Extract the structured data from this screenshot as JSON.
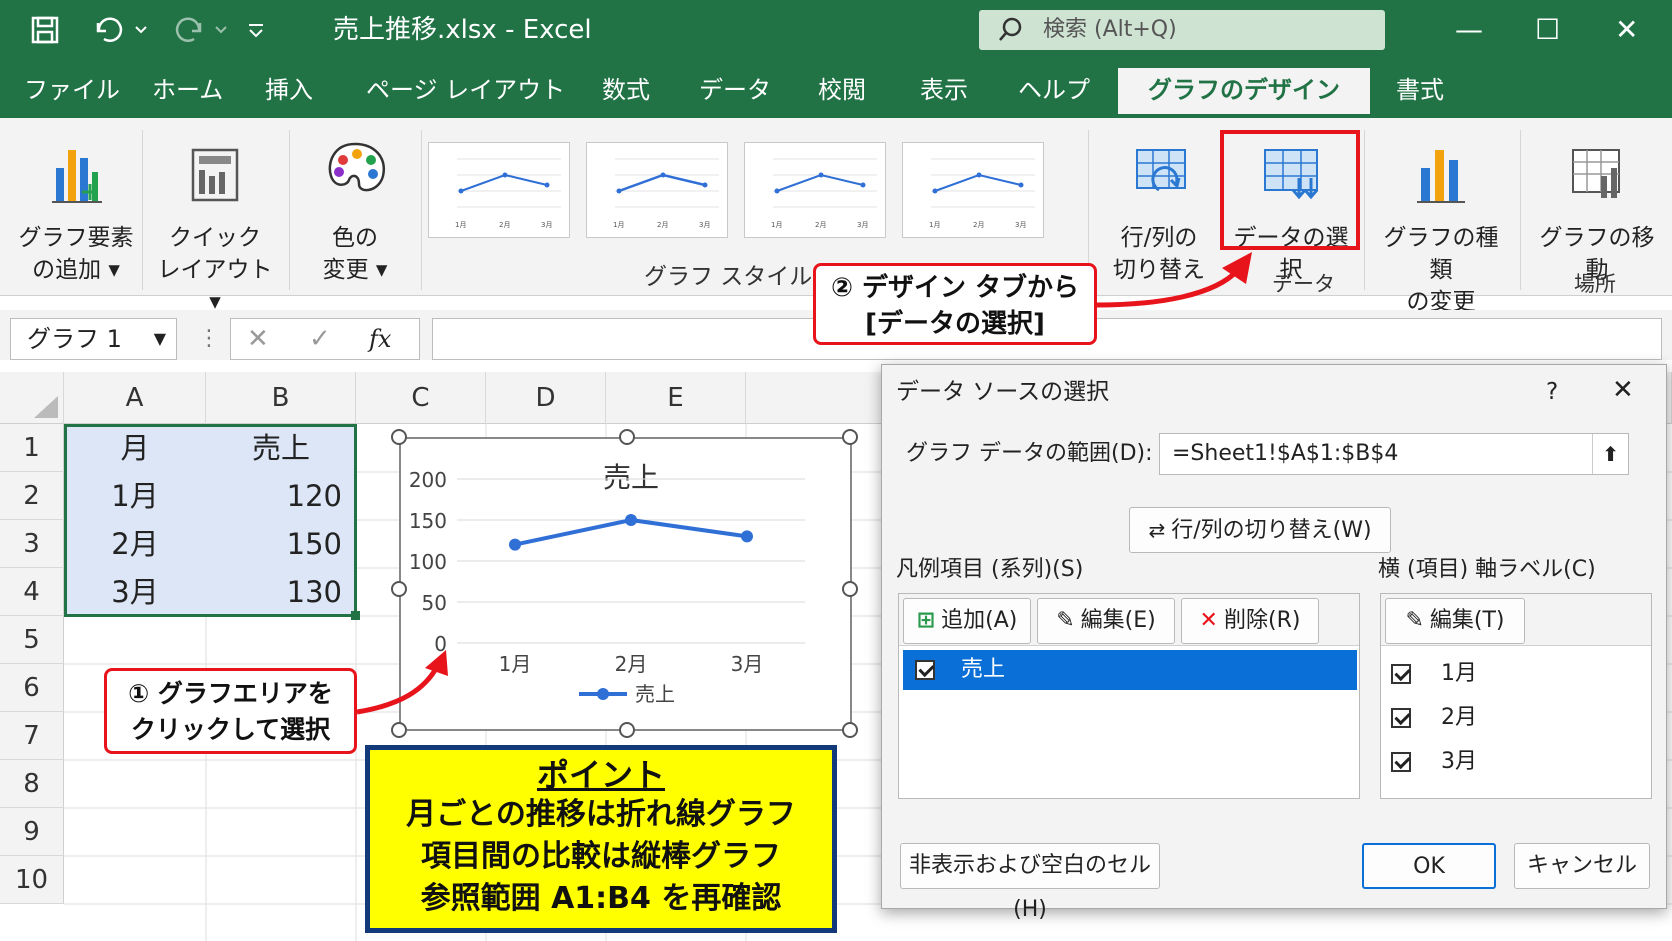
{
  "window": {
    "title": "売上推移.xlsx  -  Excel",
    "search_placeholder": "検索 (Alt+Q)",
    "min": "—",
    "max": "☐",
    "close": "✕"
  },
  "menu": {
    "tabs": [
      {
        "label": "ファイル"
      },
      {
        "label": "ホーム"
      },
      {
        "label": "挿入"
      },
      {
        "label": "ページ レイアウト"
      },
      {
        "label": "数式"
      },
      {
        "label": "データ"
      },
      {
        "label": "校閲"
      },
      {
        "label": "表示"
      },
      {
        "label": "ヘルプ"
      },
      {
        "label": "グラフのデザイン"
      },
      {
        "label": "書式"
      }
    ]
  },
  "ribbon": {
    "add_element": {
      "l1": "グラフ要素",
      "l2": "の追加 ▾"
    },
    "quick_layout": {
      "l1": "クイック",
      "l2": "レイアウト ▾"
    },
    "change_color": {
      "l1": "色の",
      "l2": "変更 ▾"
    },
    "styles_group": "グラフ スタイル",
    "thumb_labels": [
      "1月",
      "2月",
      "3月"
    ],
    "switch_rowcol": {
      "l1": "行/列の",
      "l2": "切り替え"
    },
    "select_data": {
      "l1": "データの選択"
    },
    "data_group": "データ",
    "change_type": {
      "l1": "グラフの種類",
      "l2": "の変更"
    },
    "move_chart": {
      "l1": "グラフの移動"
    },
    "location_group": "場所"
  },
  "formula_bar": {
    "name_box": "グラフ 1",
    "cancel": "✕",
    "enter": "✓",
    "fx": "fx",
    "colon": "⋮"
  },
  "sheet": {
    "columns": [
      "A",
      "B",
      "C",
      "D",
      "E"
    ],
    "rows": [
      "1",
      "2",
      "3",
      "4",
      "5",
      "6",
      "7",
      "8",
      "9",
      "10"
    ],
    "table": {
      "header": [
        "月",
        "売上"
      ],
      "data": [
        [
          "1月",
          "120"
        ],
        [
          "2月",
          "150"
        ],
        [
          "3月",
          "130"
        ]
      ]
    }
  },
  "chart_data": {
    "type": "line",
    "title": "売上",
    "categories": [
      "1月",
      "2月",
      "3月"
    ],
    "series": [
      {
        "name": "売上",
        "values": [
          120,
          150,
          130
        ],
        "color": "#2f6fd6"
      }
    ],
    "ylim": [
      0,
      200
    ],
    "yticks": [
      "0",
      "50",
      "100",
      "150",
      "200"
    ],
    "grid": true,
    "legend": "bottom"
  },
  "annotations": {
    "callout1": {
      "l1": "① グラフエリアを",
      "l2": "クリックして選択"
    },
    "callout2": {
      "l1": "② デザイン タブから",
      "l2": "[データの選択]"
    },
    "point": {
      "title": "ポイント",
      "l1": "月ごとの推移は折れ線グラフ",
      "l2": "項目間の比較は縦棒グラフ",
      "l3": "参照範囲 A1:B4 を再確認"
    }
  },
  "dialog": {
    "title": "データ ソースの選択",
    "help": "?",
    "close": "✕",
    "range_label": "グラフ データの範囲(D):",
    "range_value": "=Sheet1!$A$1:$B$4",
    "switch_button": "行/列の切り替え(W)",
    "legend_label": "凡例項目 (系列)(S)",
    "axis_label": "横 (項目) 軸ラベル(C)",
    "add": "追加(A)",
    "edit": "編集(E)",
    "delete": "削除(R)",
    "axis_edit": "編集(T)",
    "series": [
      {
        "label": "売上",
        "checked": true
      }
    ],
    "categories": [
      {
        "label": "1月",
        "checked": true
      },
      {
        "label": "2月",
        "checked": true
      },
      {
        "label": "3月",
        "checked": true
      }
    ],
    "hidden_cells": "非表示および空白のセル(H)",
    "ok": "OK",
    "cancel": "キャンセル"
  },
  "colors": {
    "excel_green": "#217346",
    "accent_red": "#e8141c",
    "select_blue": "#0a6fd6",
    "point_yellow": "#ffff00",
    "point_border": "#123a7a"
  }
}
